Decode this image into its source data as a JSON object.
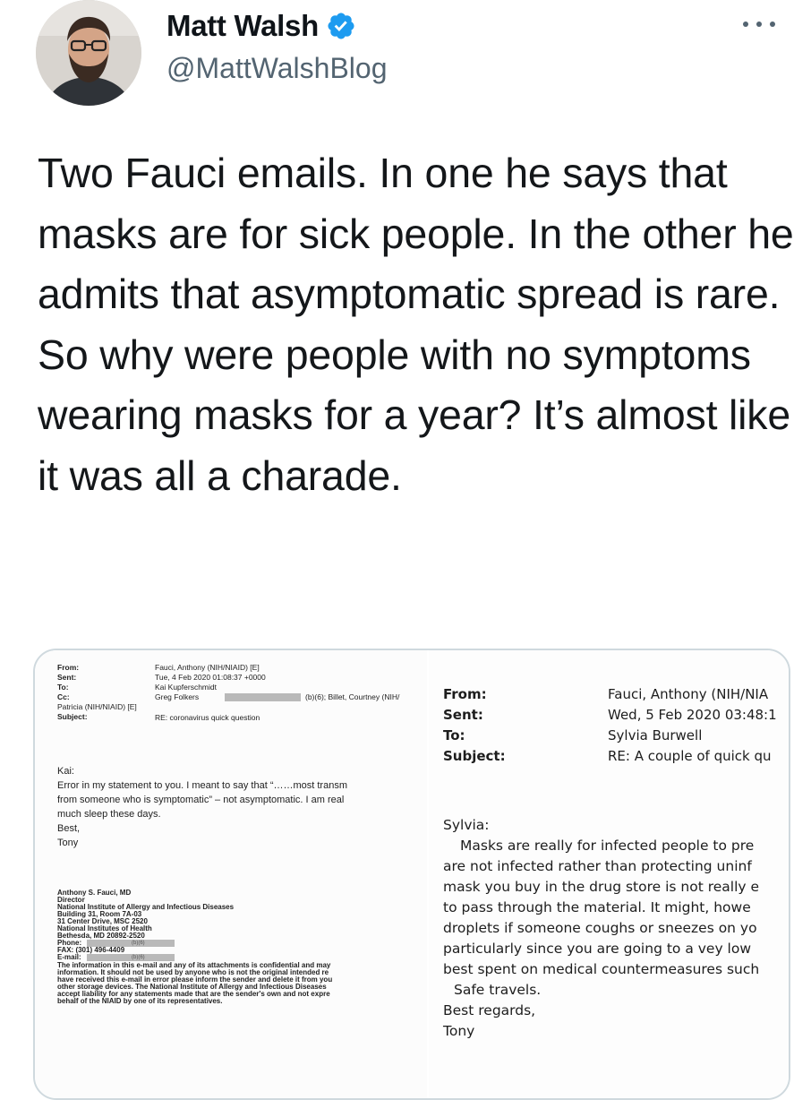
{
  "tweet": {
    "author": {
      "display_name": "Matt Walsh",
      "handle": "@MattWalshBlog",
      "verified_icon": "verified-badge-icon",
      "verified_color": "#1d9bf0"
    },
    "text": "Two Fauci emails. In one he says that masks are for sick people. In the other he admits that asymptomatic spread is rare. So why were people with no symptoms wearing masks for a year? It’s almost like it was all a charade.",
    "more_icon": "more-options-icon"
  },
  "left_email": {
    "headers": [
      {
        "label": "From:",
        "value": "Fauci, Anthony (NIH/NIAID) [E]"
      },
      {
        "label": "Sent:",
        "value": "Tue, 4 Feb 2020 01:08:37 +0000"
      },
      {
        "label": "To:",
        "value": "Kai Kupferschmidt"
      },
      {
        "label": "Cc:",
        "value": "Greg Folkers"
      },
      {
        "label": "",
        "value": "Patricia (NIH/NIAID) [E]"
      },
      {
        "label": "Subject:",
        "value": "RE: coronavirus quick question"
      }
    ],
    "cc_extra": "(b)(6); Billet, Courtney (NIH/",
    "greeting": "Kai:",
    "body": [
      "Error in my statement to you.  I meant to say that “……most transm",
      "from someone who is symptomatic” – not asymptomatic.  I am real",
      "much sleep these days."
    ],
    "closing": "Best,",
    "sign": "Tony",
    "signature": [
      "Anthony S. Fauci, MD",
      "Director",
      "National Institute of Allergy and Infectious Diseases",
      "Building 31, Room 7A-03",
      "31 Center Drive, MSC 2520",
      "National Institutes of Health",
      "Bethesda, MD 20892-2520",
      "Phone:",
      "FAX: (301) 496-4409",
      "E-mail:"
    ],
    "redaction_label": "(b)(6)",
    "disclaimer": [
      "The information in this e-mail and any of its attachments is confidential and may",
      "information.  It should not be used by anyone who is not the original intended re",
      "have received this e-mail in error please inform the sender and delete it from you",
      "other storage devices.  The National Institute of Allergy and Infectious Diseases",
      "accept liability for any statements made that are the sender's own and not expre",
      "behalf of the NIAID by one of its representatives."
    ]
  },
  "right_email": {
    "headers": [
      {
        "label": "From:",
        "value": "Fauci, Anthony (NIH/NIA"
      },
      {
        "label": "Sent:",
        "value": "Wed, 5 Feb 2020 03:48:1"
      },
      {
        "label": "To:",
        "value": "Sylvia Burwell"
      },
      {
        "label": "Subject:",
        "value": "RE: A couple of quick qu"
      }
    ],
    "greeting": "Sylvia:",
    "body": [
      "Masks are really for infected people to pre",
      "are not infected rather than protecting uninf",
      "mask you buy in the drug store is not really e",
      "to pass through the material.  It might, howe",
      "droplets if someone coughs or sneezes on yo",
      "particularly since you are going to a vey low",
      "best spent on medical countermeasures such"
    ],
    "farewell": "Safe travels.",
    "closing": "Best regards,",
    "sign": "Tony"
  }
}
